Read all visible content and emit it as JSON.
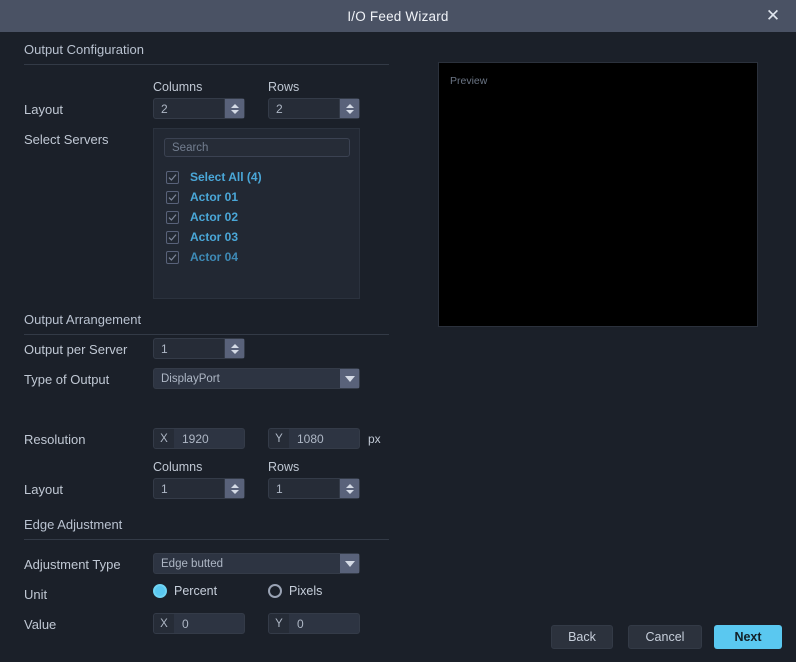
{
  "window": {
    "title": "I/O Feed Wizard",
    "close_icon": "close-icon"
  },
  "sections": {
    "output_configuration": {
      "title": "Output Configuration",
      "layout_label": "Layout",
      "columns_header": "Columns",
      "rows_header": "Rows",
      "columns_value": "2",
      "rows_value": "2",
      "select_servers_label": "Select Servers"
    },
    "servers": {
      "search_placeholder": "Search",
      "search_value": "",
      "items": [
        {
          "label": "Select All (4)",
          "checked": true
        },
        {
          "label": "Actor 01",
          "checked": true
        },
        {
          "label": "Actor 02",
          "checked": true
        },
        {
          "label": "Actor 03",
          "checked": true
        },
        {
          "label": "Actor 04",
          "checked": true
        }
      ]
    },
    "output_arrangement": {
      "title": "Output Arrangement",
      "output_per_server_label": "Output per Server",
      "output_per_server_value": "1",
      "type_of_output_label": "Type of Output",
      "type_of_output_value": "DisplayPort",
      "resolution_label": "Resolution",
      "resolution_x_prefix": "X",
      "resolution_x_value": "1920",
      "resolution_y_prefix": "Y",
      "resolution_y_value": "1080",
      "resolution_unit": "px",
      "layout_label": "Layout",
      "columns_header": "Columns",
      "rows_header": "Rows",
      "columns_value": "1",
      "rows_value": "1"
    },
    "edge_adjustment": {
      "title": "Edge Adjustment",
      "adjustment_type_label": "Adjustment Type",
      "adjustment_type_value": "Edge butted",
      "unit_label": "Unit",
      "unit_percent_label": "Percent",
      "unit_pixels_label": "Pixels",
      "unit_selected": "Percent",
      "value_label": "Value",
      "value_x_prefix": "X",
      "value_x_value": "0",
      "value_y_prefix": "Y",
      "value_y_value": "0"
    }
  },
  "preview": {
    "label": "Preview"
  },
  "footer": {
    "back_label": "Back",
    "cancel_label": "Cancel",
    "next_label": "Next"
  },
  "colors": {
    "accent": "#5ac8f0",
    "titlebar": "#4a5264",
    "background": "#1b2029",
    "server_label": "#4aa7d8"
  }
}
